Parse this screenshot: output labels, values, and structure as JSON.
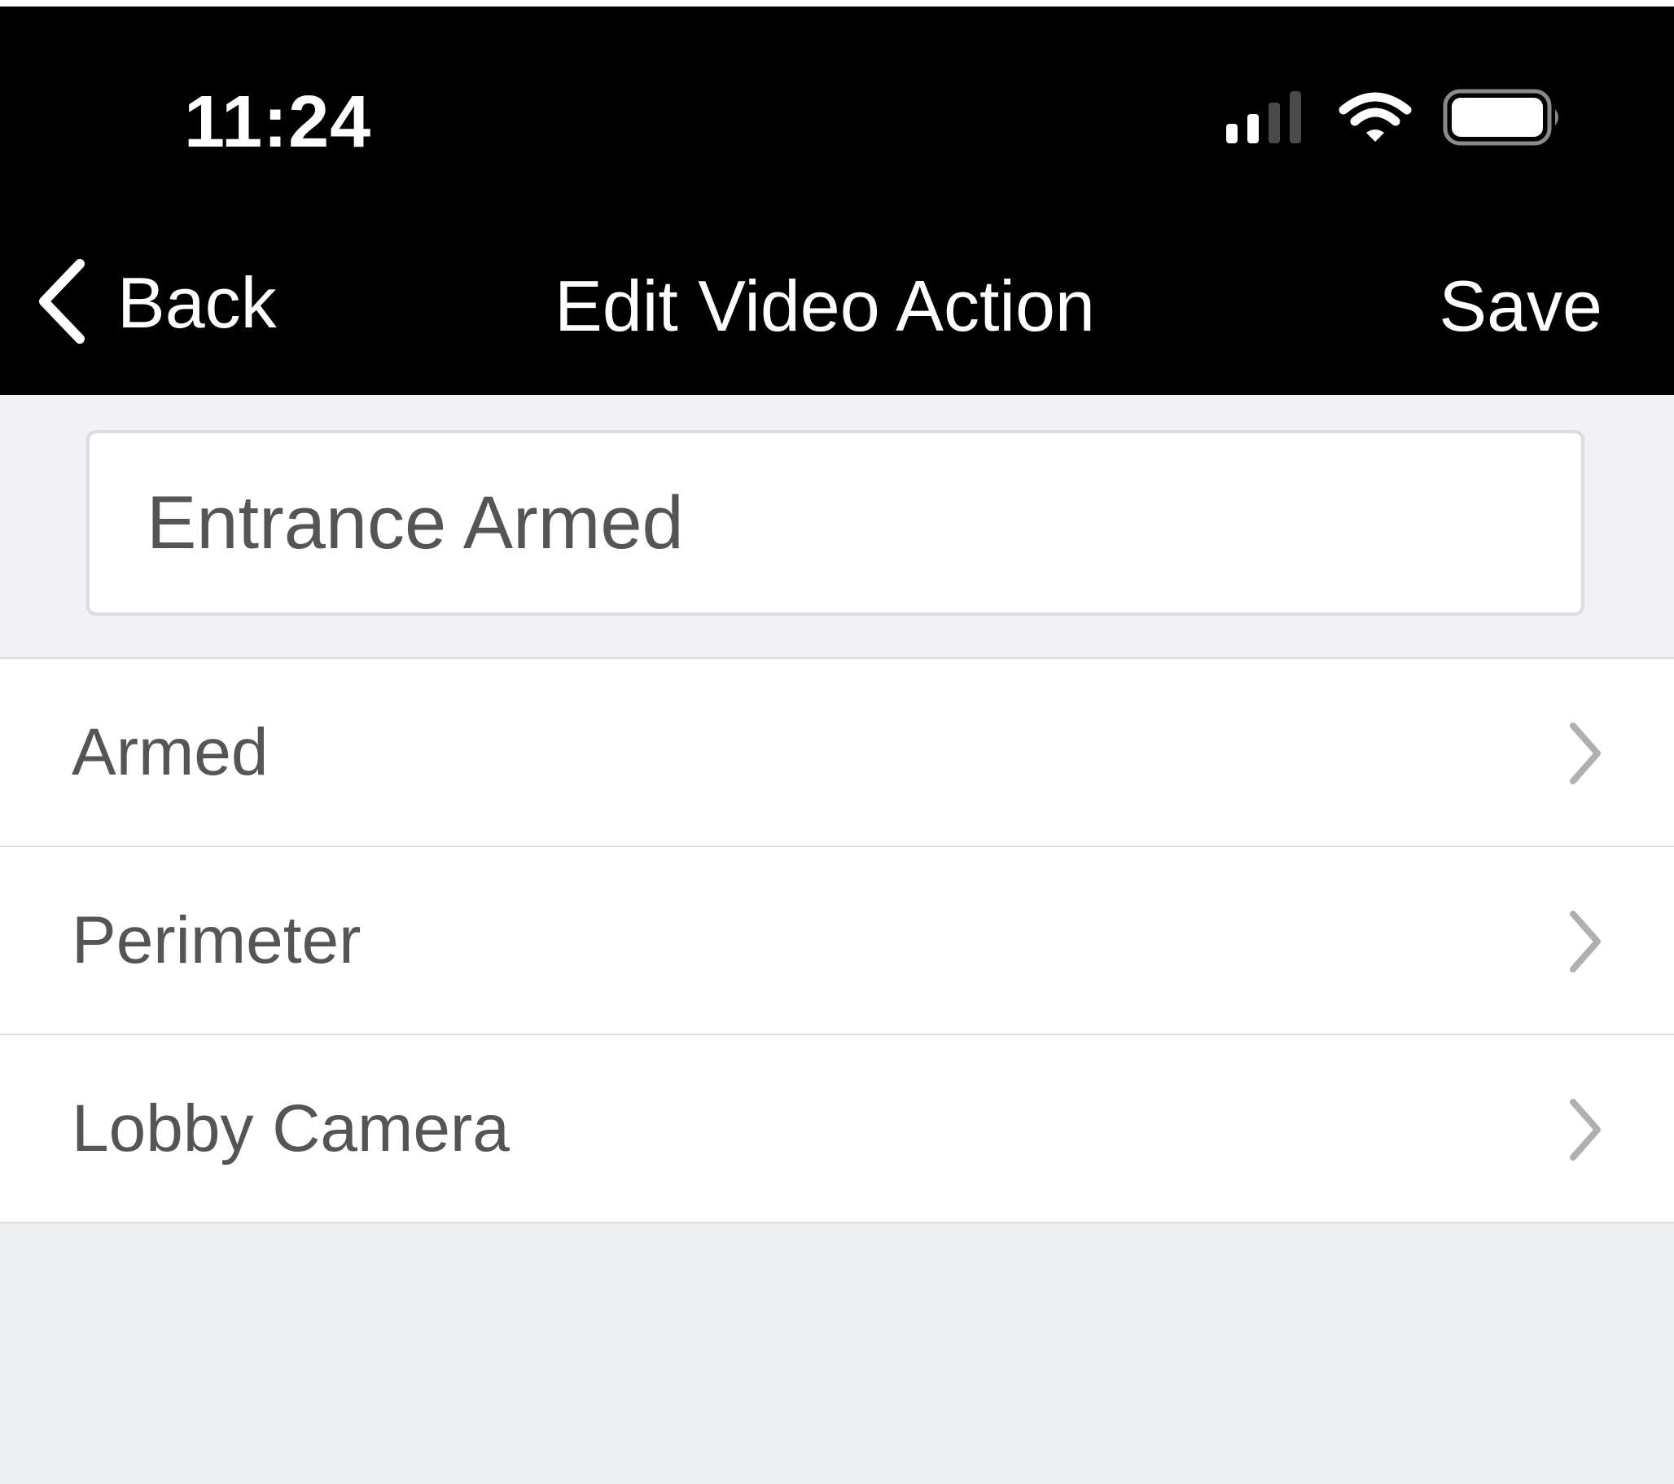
{
  "status_bar": {
    "time": "11:24",
    "signal_icon": "cellular-signal-icon",
    "wifi_icon": "wifi-icon",
    "battery_icon": "battery-icon"
  },
  "navbar": {
    "back_label": "Back",
    "back_icon": "chevron-left-icon",
    "title": "Edit Video Action",
    "save_label": "Save"
  },
  "name_field": {
    "value": "Entrance Armed"
  },
  "list": {
    "items": [
      {
        "label": "Armed",
        "icon": "chevron-right-icon"
      },
      {
        "label": "Perimeter",
        "icon": "chevron-right-icon"
      },
      {
        "label": "Lobby Camera",
        "icon": "chevron-right-icon"
      }
    ]
  },
  "colors": {
    "header_bg": "#000000",
    "header_text": "#ffffff",
    "page_bg": "#f1f1f5",
    "list_text": "#555555",
    "chevron": "#b0b0b0"
  }
}
